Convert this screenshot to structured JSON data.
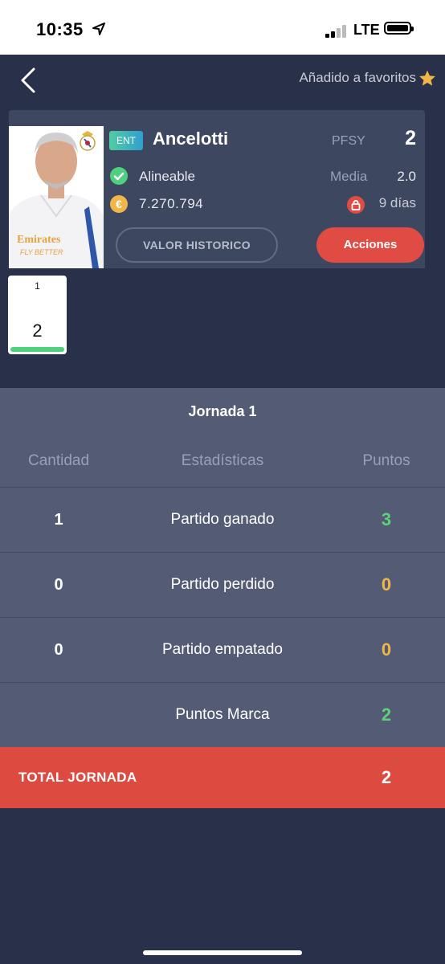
{
  "status_bar": {
    "time": "10:35",
    "network": "LTE"
  },
  "header": {
    "favorites_text": "Añadido a favoritos"
  },
  "player": {
    "position": "ENT",
    "name": "Ancelotti",
    "points_label": "PFSY",
    "points_value": "2",
    "status": "Alineable",
    "media_label": "Media",
    "media_value": "2.0",
    "market_value": "7.270.794",
    "lock_days": "9 días",
    "photo_sponsor_line1": "Emirates",
    "photo_sponsor_line2": "FLY BETTER"
  },
  "buttons": {
    "history": "VALOR HISTORICO",
    "actions": "Acciones"
  },
  "matchdays": [
    {
      "number": "1",
      "points": "2",
      "bar_fraction": 1.0
    }
  ],
  "stats": {
    "title": "Jornada 1",
    "columns": [
      "Cantidad",
      "Estadísticas",
      "Puntos"
    ],
    "rows": [
      {
        "quantity": "1",
        "stat": "Partido ganado",
        "points": "3",
        "color": "#5cd17a"
      },
      {
        "quantity": "0",
        "stat": "Partido perdido",
        "points": "0",
        "color": "#f2b548"
      },
      {
        "quantity": "0",
        "stat": "Partido empatado",
        "points": "0",
        "color": "#f2b548"
      },
      {
        "quantity": "",
        "stat": "Puntos Marca",
        "points": "2",
        "color": "#5cd17a"
      }
    ],
    "total_label": "TOTAL JORNADA",
    "total_value": "2"
  },
  "colors": {
    "accent_red": "#e04c43",
    "background": "#293049",
    "card": "#3e4760",
    "panel": "#545c75"
  }
}
